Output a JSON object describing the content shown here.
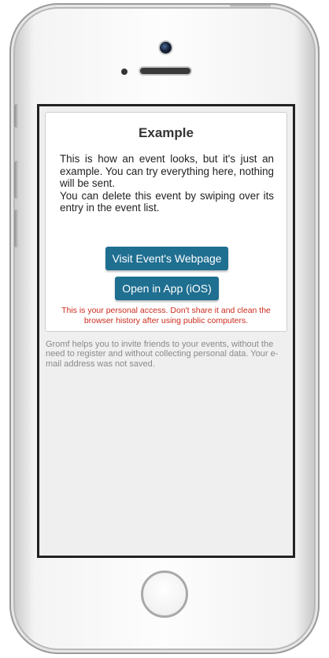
{
  "event": {
    "title": "Example",
    "description": "This is how an event looks, but it's just an example. You can try everything here, nothing will be sent.\nYou can delete this event by swiping over its entry in the event list."
  },
  "buttons": {
    "visit_webpage": "Visit Event's Webpage",
    "open_in_app": "Open in App (iOS)"
  },
  "warning": "This is your personal access. Don't share it and clean the browser history after using public computers.",
  "footer": "Gromf helps you to invite friends to your events, without the need to register and without collecting personal data. Your e-mail address was not saved.",
  "colors": {
    "button_bg": "#1f6f91",
    "warning_text": "#cc2b1c"
  }
}
